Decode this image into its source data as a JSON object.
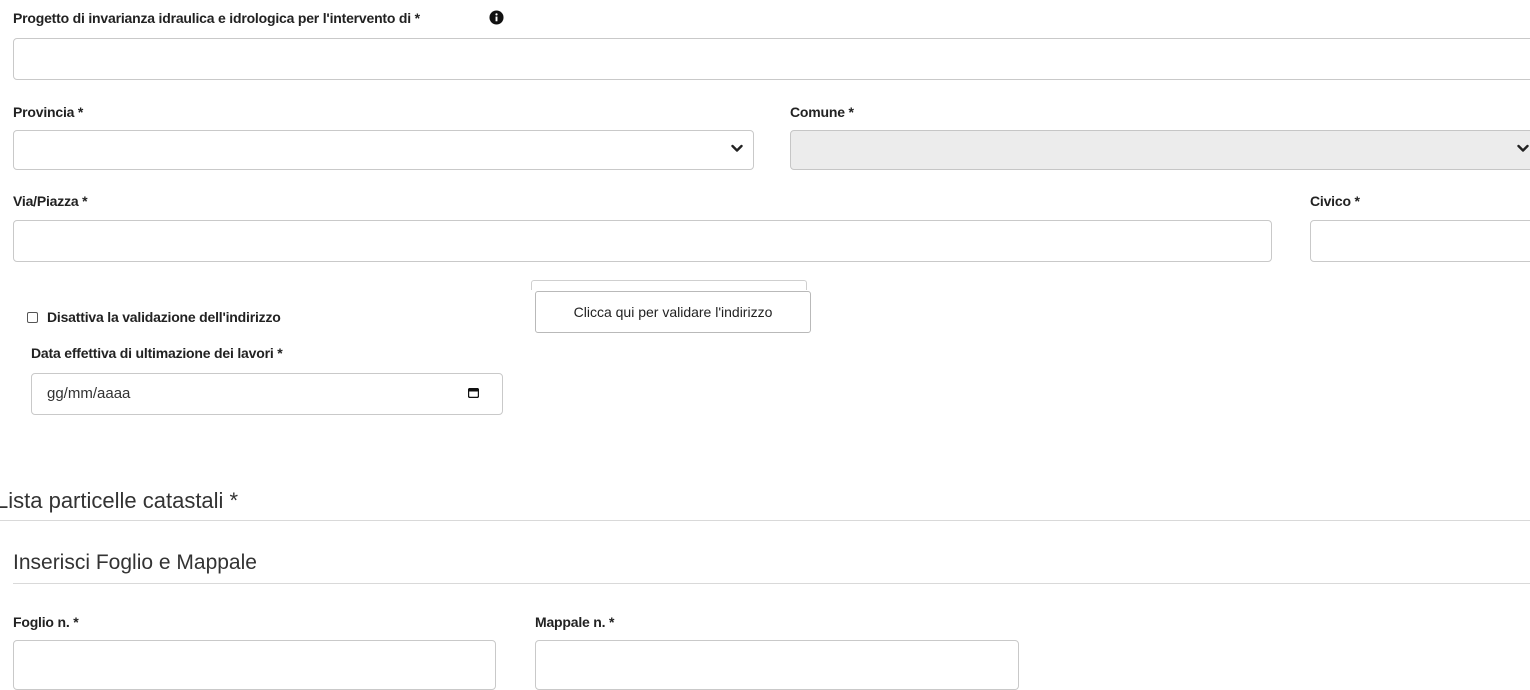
{
  "project": {
    "label": "Progetto di invarianza idraulica e idrologica per l'intervento di *",
    "value": ""
  },
  "provincia": {
    "label": "Provincia *",
    "value": ""
  },
  "comune": {
    "label": "Comune *",
    "value": ""
  },
  "via": {
    "label": "Via/Piazza *",
    "value": ""
  },
  "civico": {
    "label": "Civico *",
    "value": ""
  },
  "address_validation": {
    "checkbox_label": "Disattiva la validazione dell'indirizzo",
    "checked": false,
    "button_label": "Clicca qui per validare l'indirizzo"
  },
  "completion_date": {
    "label": "Data effettiva di ultimazione dei lavori *",
    "placeholder": "gg/mm/aaaa"
  },
  "parcels": {
    "title": "Lista particelle catastali *",
    "subtitle": "Inserisci Foglio e Mappale",
    "foglio_label": "Foglio n. *",
    "mappale_label": "Mappale n. *"
  },
  "icons": [
    "info-icon",
    "chevron-down-icon",
    "calendar-icon"
  ]
}
